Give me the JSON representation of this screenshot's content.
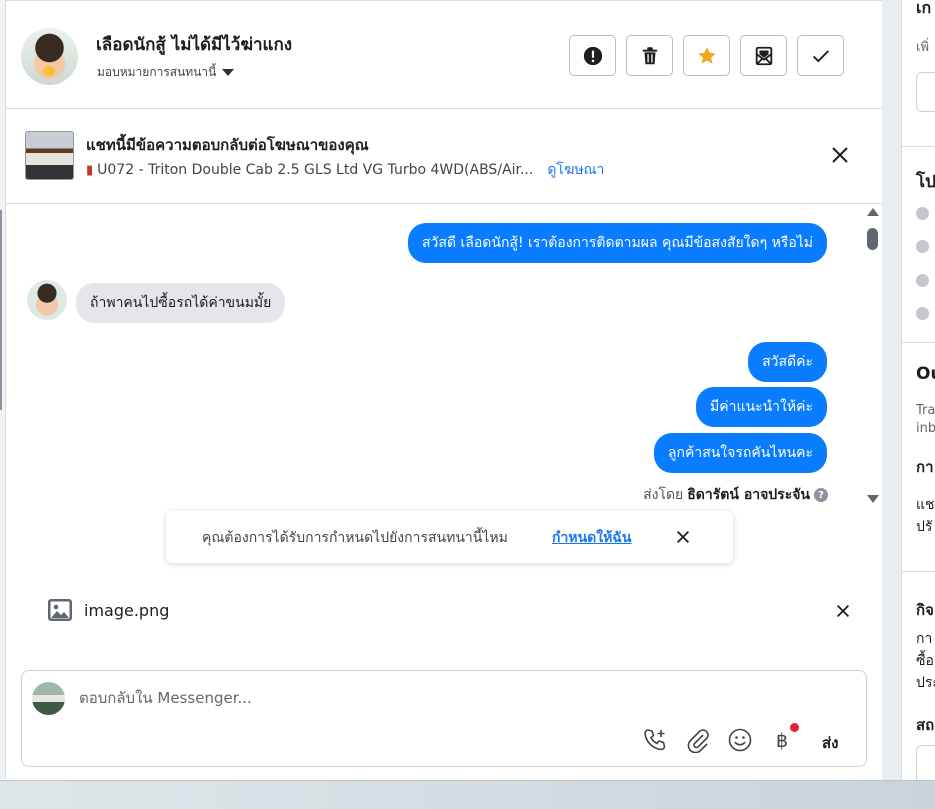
{
  "header": {
    "contact_name": "เลือดนักสู้ ไม่ได้มีไว้ฆ่าแกง",
    "assign_label": "มอบหมายการสนทนานี้"
  },
  "ad_banner": {
    "title": "แชทนี้มีข้อความตอบกลับต่อโฆษณาของคุณ",
    "ad_name": "U072 - Triton Double Cab 2.5 GLS Ltd VG Turbo 4WD(ABS/Air...",
    "view_ad_link": "ดูโฆษณา"
  },
  "messages": [
    {
      "direction": "out",
      "text": "สวัสดี เลือดนักสู้! เราต้องการติดตามผล คุณมีข้อสงสัยใดๆ หรือไม่"
    },
    {
      "direction": "in",
      "text": "ถ้าพาคนไปซื้อรถได้ค่าขนมมั้ย"
    },
    {
      "direction": "out",
      "text": "สวัสดีค่ะ"
    },
    {
      "direction": "out",
      "text": "มีค่าแนะนำให้ค่ะ"
    },
    {
      "direction": "out",
      "text": "ลูกค้าสนใจรถคันไหนคะ"
    }
  ],
  "sent_by": {
    "prefix": "ส่งโดย",
    "name": "ธิดารัตน์ อาจประจัน"
  },
  "assign_toast": {
    "text": "คุณต้องการได้รับการกำหนดไปยังการสนทนานี้ไหม",
    "link": "กำหนดให้ฉัน"
  },
  "attachment": {
    "filename": "image.png"
  },
  "composer": {
    "placeholder": "ตอบกลับใน Messenger...",
    "send_label": "ส่ง"
  },
  "right_panel": {
    "heading_top": "เก",
    "sub_top": "เพิ่",
    "heading_profile": "โป",
    "heading_ou": "Ou",
    "sub_ou_1": "Tra",
    "sub_ou_2": "inb",
    "heading_ka": "กา",
    "text_1": "แช",
    "text_2": "ปรั",
    "heading_activity": "กิจ",
    "text_3": "กา",
    "text_4": "ซื้อ",
    "text_5": "ประ",
    "heading_status": "สถ"
  },
  "colors": {
    "accent": "#0a7cff",
    "link": "#1877f2",
    "star": "#f5a623",
    "notification_dot": "#e41e3f"
  }
}
